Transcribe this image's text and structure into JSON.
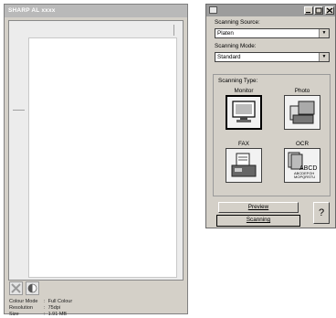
{
  "left_window": {
    "title": "SHARP AL xxxx",
    "info": {
      "colour_mode_label": "Colour Mode",
      "colour_mode_value": "Full Colour",
      "resolution_label": "Resolution",
      "resolution_value": "75dpi",
      "size_label": "Size",
      "size_value": "1.91 MB",
      "separator": ":"
    }
  },
  "dialog": {
    "scanning_source_label": "Scanning Source:",
    "scanning_source_value": "Platen",
    "scanning_mode_label": "Scanning Mode:",
    "scanning_mode_value": "Standard",
    "scanning_type_label": "Scanning Type:",
    "types": {
      "monitor": "Monitor",
      "photo": "Photo",
      "fax": "FAX",
      "ocr": "OCR"
    },
    "ocr_icon_text_1": "ABCD",
    "ocr_icon_text_2": "ABCDEFGH",
    "ocr_icon_text_3": "MOPQRSTU",
    "preview_button": "Preview",
    "scanning_button": "Scanning",
    "help_glyph": "?"
  },
  "colors": {
    "face": "#d4d0c8",
    "title_gray": "#9c9c9c"
  }
}
